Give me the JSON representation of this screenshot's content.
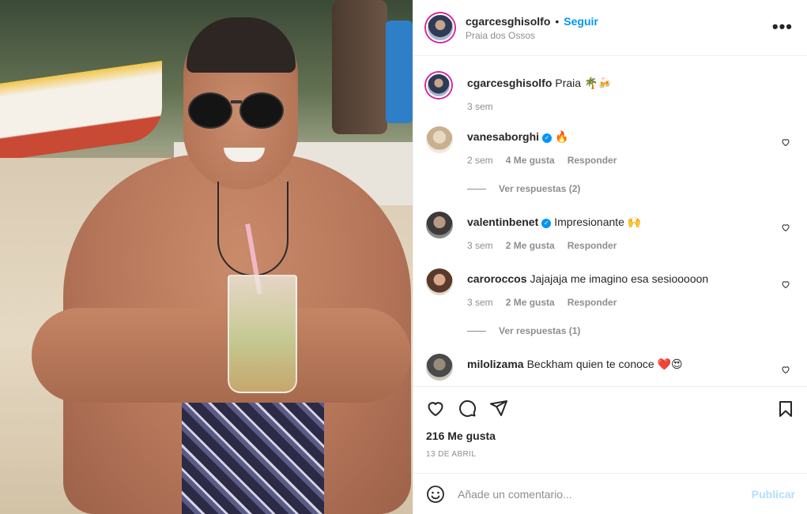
{
  "post": {
    "author": "cgarcesghisolfo",
    "follow_label": "Seguir",
    "separator": "•",
    "location": "Praia dos Ossos",
    "more_label": "•••",
    "caption": {
      "user": "cgarcesghisolfo",
      "text": "Praia 🌴🍻",
      "time": "3 sem"
    }
  },
  "comments": [
    {
      "user": "vanesaborghi",
      "verified": true,
      "text": "🔥",
      "time": "2 sem",
      "likes": "4 Me gusta",
      "reply_label": "Responder",
      "view_replies": "Ver respuestas (2)"
    },
    {
      "user": "valentinbenet",
      "verified": true,
      "text": "Impresionante 🙌",
      "time": "3 sem",
      "likes": "2 Me gusta",
      "reply_label": "Responder",
      "view_replies": ""
    },
    {
      "user": "caroroccos",
      "verified": false,
      "text": "Jajajaja me imagino esa sesiooooon",
      "time": "3 sem",
      "likes": "2 Me gusta",
      "reply_label": "Responder",
      "view_replies": "Ver respuestas (1)"
    },
    {
      "user": "milolizama",
      "verified": false,
      "text": "Beckham quien te conoce ❤️😍",
      "time": "",
      "likes": "",
      "reply_label": "",
      "view_replies": ""
    }
  ],
  "actions": {
    "likes_count": "216 Me gusta",
    "date": "13 DE ABRIL"
  },
  "add_comment": {
    "placeholder": "Añade un comentario...",
    "publish_label": "Publicar"
  },
  "icons": {
    "like": "heart-icon",
    "comment": "comment-icon",
    "share": "send-icon",
    "save": "bookmark-icon",
    "emoji": "emoji-icon",
    "verified": "verified-badge-icon"
  },
  "colors": {
    "accent": "#0095f6",
    "publish_disabled": "#b2dffc",
    "secondary_text": "#8e8e8e"
  }
}
